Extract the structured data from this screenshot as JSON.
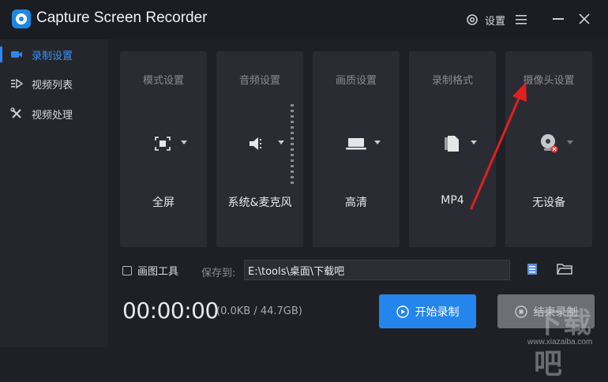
{
  "app": {
    "title": "Capture Screen Recorder"
  },
  "header": {
    "settings_label": "设置"
  },
  "sidebar": {
    "items": [
      {
        "label": "录制设置",
        "icon": "camera-icon",
        "active": true
      },
      {
        "label": "视频列表",
        "icon": "video-list-icon",
        "active": false
      },
      {
        "label": "视频处理",
        "icon": "tools-icon",
        "active": false
      }
    ]
  },
  "cards": [
    {
      "title": "模式设置",
      "value": "全屏",
      "icon": "fullscreen-icon"
    },
    {
      "title": "音频设置",
      "value": "系统&麦克风",
      "icon": "speaker-icon"
    },
    {
      "title": "画质设置",
      "value": "高清",
      "icon": "laptop-icon"
    },
    {
      "title": "录制格式",
      "value": "MP4",
      "icon": "file-icon"
    },
    {
      "title": "摄像头设置",
      "value": "无设备",
      "icon": "webcam-icon"
    }
  ],
  "bottom": {
    "draw_tool_label": "画图工具",
    "save_to_label": "保存到:",
    "save_path": "E:\\tools\\桌面\\下载吧",
    "timer": "00:00:00",
    "size_info": "(0.0KB / 44.7GB)",
    "start_label": "开始录制",
    "stop_label": "结束录制"
  },
  "watermark": {
    "big": "下载吧",
    "small": "www.xiazaiba.com"
  },
  "colors": {
    "accent": "#2485ec",
    "annotation_arrow": "#e02020"
  }
}
